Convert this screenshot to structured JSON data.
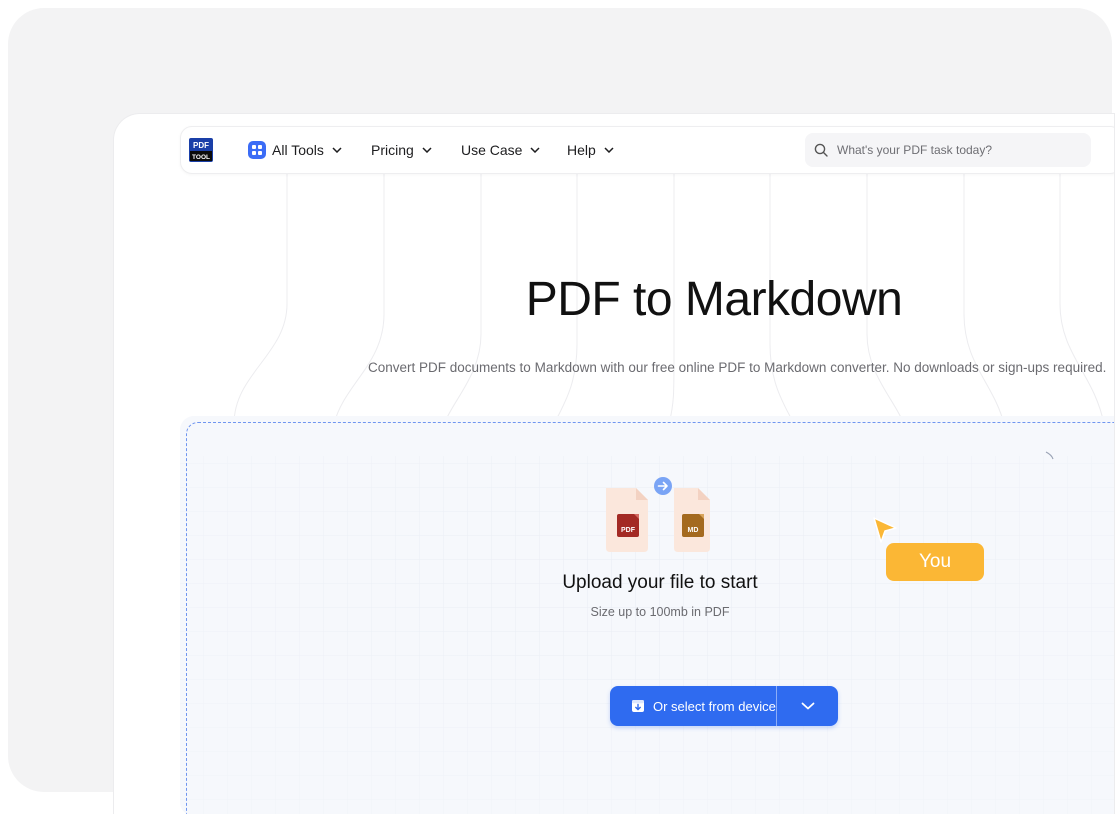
{
  "nav": {
    "logo_text_top": "PDF",
    "logo_text_bottom": "TOOL",
    "items": [
      {
        "label": "All Tools"
      },
      {
        "label": "Pricing"
      },
      {
        "label": "Use Case"
      },
      {
        "label": "Help"
      }
    ],
    "search_placeholder": "What's your PDF task today?"
  },
  "hero": {
    "title": "PDF to Markdown",
    "subtitle": "Convert PDF documents to Markdown with our free online PDF to Markdown converter. No downloads or sign-ups required."
  },
  "upload": {
    "title": "Upload your file to start",
    "hint": "Size up to 100mb in PDF",
    "select_button": "Or select from device",
    "source_badge": "PDF",
    "target_badge": "MD"
  },
  "cursor_label": "You",
  "colors": {
    "accent": "#2f6bf0",
    "cursor": "#fbb735",
    "pdf_badge": "#a32a24",
    "md_badge": "#a46a1f"
  }
}
